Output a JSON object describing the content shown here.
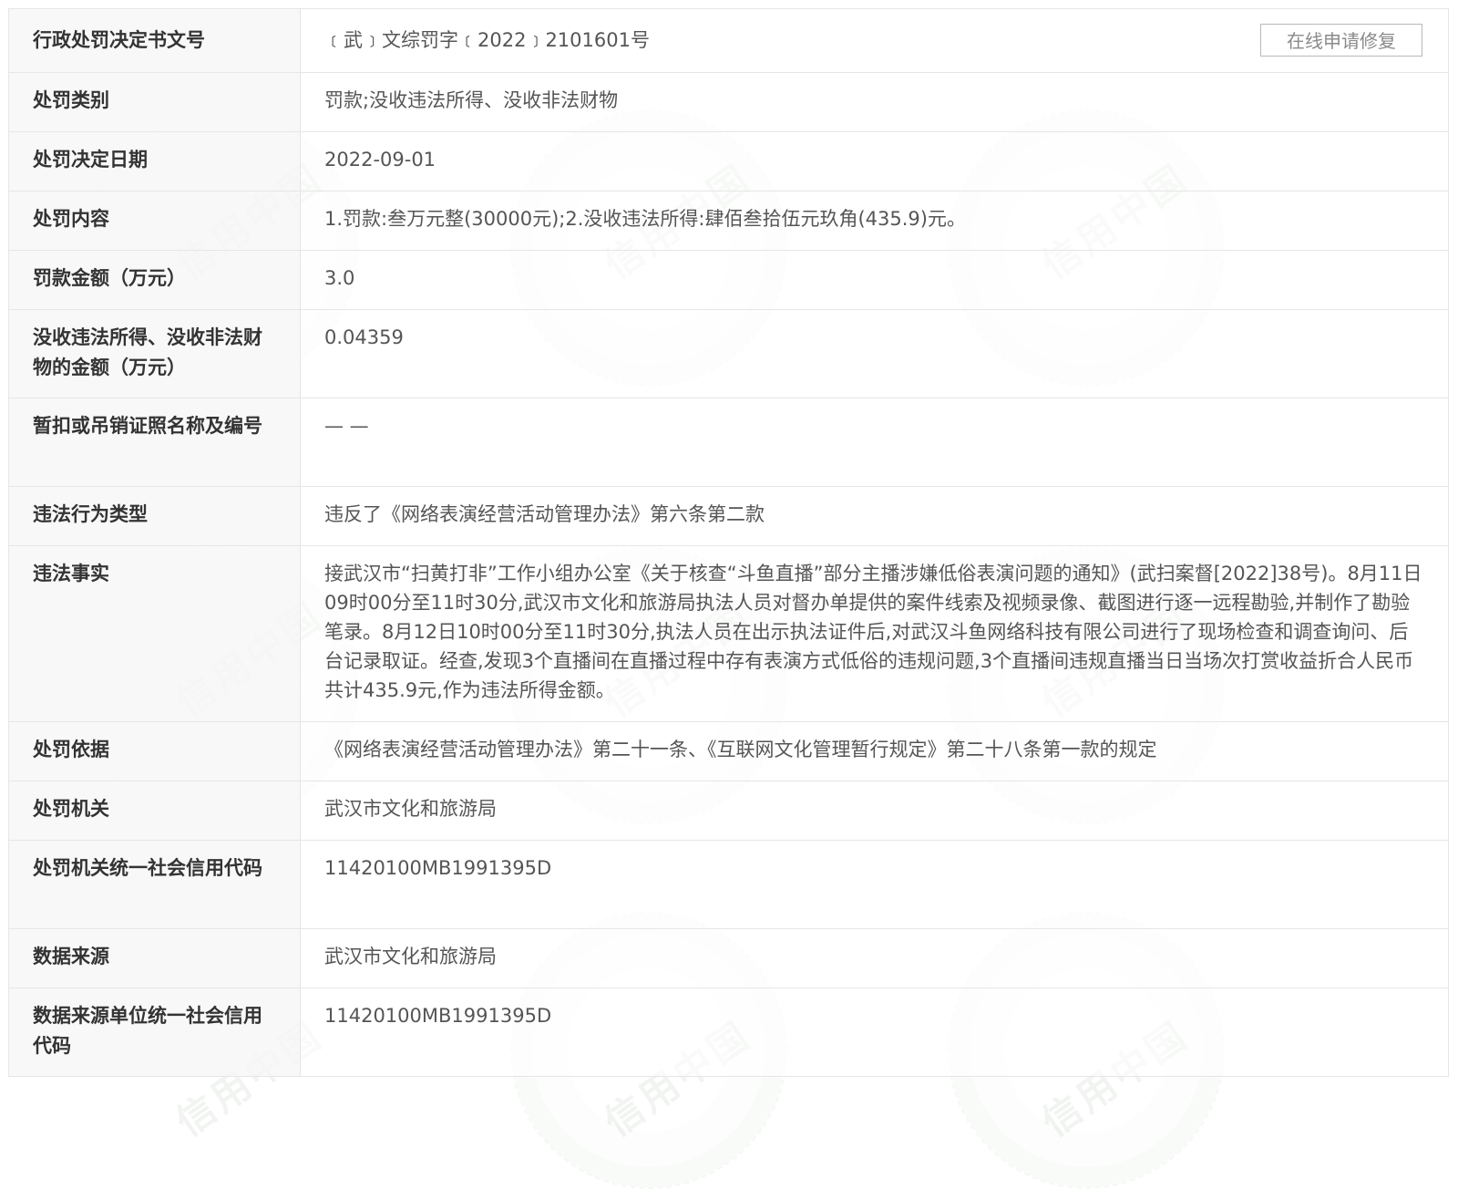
{
  "watermark": {
    "text": "信用中国"
  },
  "repair_button_label": "在线申请修复",
  "rows": [
    {
      "label": "行政处罚决定书文号",
      "value": "﹝武﹞文综罚字﹝2022﹞2101601号"
    },
    {
      "label": "处罚类别",
      "value": "罚款;没收违法所得、没收非法财物"
    },
    {
      "label": "处罚决定日期",
      "value": "2022-09-01"
    },
    {
      "label": "处罚内容",
      "value": "1.罚款:叁万元整(30000元);2.没收违法所得:肆佰叁拾伍元玖角(435.9)元。"
    },
    {
      "label": "罚款金额（万元）",
      "value": "3.0"
    },
    {
      "label": "没收违法所得、没收非法财物的金额（万元）",
      "value": "0.04359"
    },
    {
      "label": "暂扣或吊销证照名称及编号",
      "value": "— —"
    },
    {
      "label": "违法行为类型",
      "value": "违反了《网络表演经营活动管理办法》第六条第二款"
    },
    {
      "label": "违法事实",
      "value": "接武汉市“扫黄打非”工作小组办公室《关于核查“斗鱼直播”部分主播涉嫌低俗表演问题的通知》(武扫案督[2022]38号)。8月11日09时00分至11时30分,武汉市文化和旅游局执法人员对督办单提供的案件线索及视频录像、截图进行逐一远程勘验,并制作了勘验笔录。8月12日10时00分至11时30分,执法人员在出示执法证件后,对武汉斗鱼网络科技有限公司进行了现场检查和调查询问、后台记录取证。经查,发现3个直播间在直播过程中存有表演方式低俗的违规问题,3个直播间违规直播当日当场次打赏收益折合人民币共计435.9元,作为违法所得金额。"
    },
    {
      "label": "处罚依据",
      "value": "《网络表演经营活动管理办法》第二十一条、《互联网文化管理暂行规定》第二十八条第一款的规定"
    },
    {
      "label": "处罚机关",
      "value": "武汉市文化和旅游局"
    },
    {
      "label": "处罚机关统一社会信用代码",
      "value": "11420100MB1991395D"
    },
    {
      "label": "数据来源",
      "value": "武汉市文化和旅游局"
    },
    {
      "label": "数据来源单位统一社会信用代码",
      "value": "11420100MB1991395D"
    }
  ]
}
